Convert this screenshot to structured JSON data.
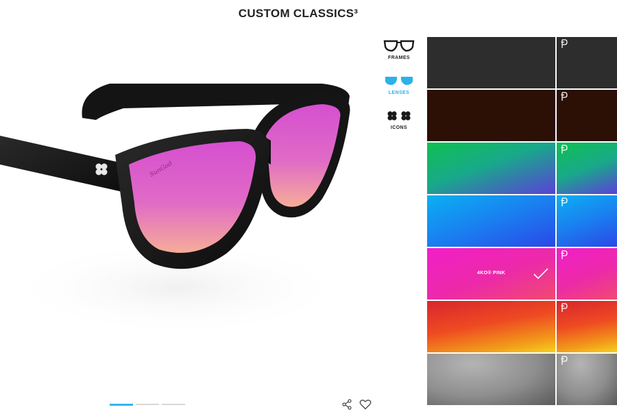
{
  "page": {
    "title": "CUSTOM CLASSICS³"
  },
  "tabs": [
    {
      "label": "FRAMES",
      "icon": "glasses-outline-icon",
      "active": false
    },
    {
      "label": "LENSES",
      "icon": "lenses-icon",
      "active": true
    },
    {
      "label": "ICONS",
      "icon": "clover-icon",
      "active": false
    }
  ],
  "swatches": [
    {
      "main": "#2d2d2d",
      "side": "#2d2d2d"
    },
    {
      "main": "#2c0f05",
      "side": "#2c0f05"
    },
    {
      "main": "green-purple gradient",
      "side": "green-purple gradient"
    },
    {
      "main": "blue gradient",
      "side": "blue gradient"
    },
    {
      "main": "pink gradient",
      "side": "pink gradient",
      "name": "4KO® PINK",
      "selected": true
    },
    {
      "main": "red-orange-yellow gradient",
      "side": "red-orange-yellow gradient"
    },
    {
      "main": "grey gradient",
      "side": "grey gradient"
    }
  ],
  "colors": {
    "accent": "#2cb1ea",
    "frame": "#151515",
    "lens_pink": "#e462cf",
    "lens_peach": "#f29ea1"
  },
  "pager": {
    "count": 3,
    "active_index": 0
  },
  "actions": [
    {
      "icon": "share-icon"
    },
    {
      "icon": "heart-icon"
    }
  ]
}
